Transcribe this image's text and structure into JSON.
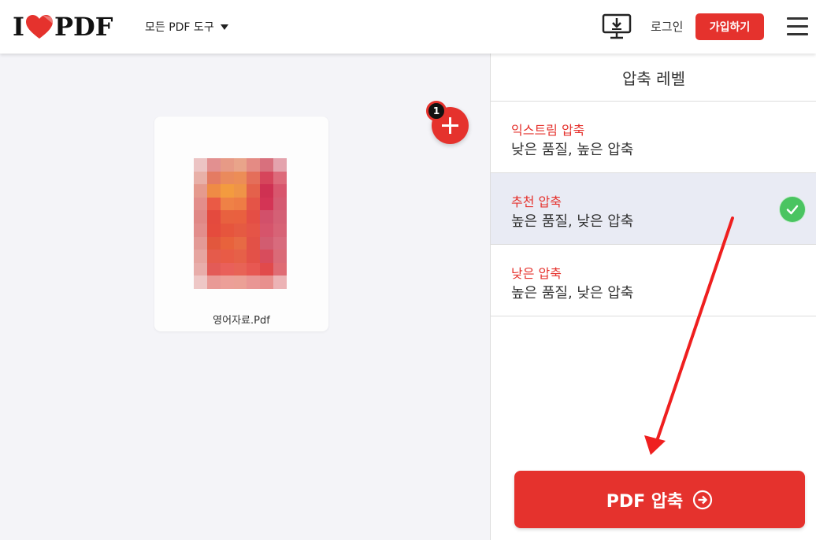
{
  "header": {
    "logo": {
      "prefix": "I",
      "suffix": "PDF",
      "heart_color": "#e5322d"
    },
    "tools_menu_label": "모든 PDF 도구",
    "login_label": "로그인",
    "signup_label": "가입하기",
    "icons": {
      "desktop": "desktop-download-icon",
      "menu": "hamburger-menu-icon",
      "tools_caret": "caret-down-icon"
    }
  },
  "workspace": {
    "file": {
      "name": "영어자료.Pdf"
    },
    "file_count_badge": "1",
    "add_icon": "plus-icon"
  },
  "sidebar": {
    "title": "압축 레벨",
    "options": [
      {
        "name": "익스트림 압축",
        "desc": "낮은 품질, 높은 압축",
        "selected": false
      },
      {
        "name": "추천 압축",
        "desc": "높은 품질, 낮은 압축",
        "selected": true
      },
      {
        "name": "낮은 압축",
        "desc": "높은 품질, 낮은 압축",
        "selected": false
      }
    ],
    "compress_label": "PDF 압축"
  },
  "colors": {
    "brand_red": "#e5322d",
    "check_green": "#4ac461",
    "selected_bg": "#e9ebf4"
  }
}
